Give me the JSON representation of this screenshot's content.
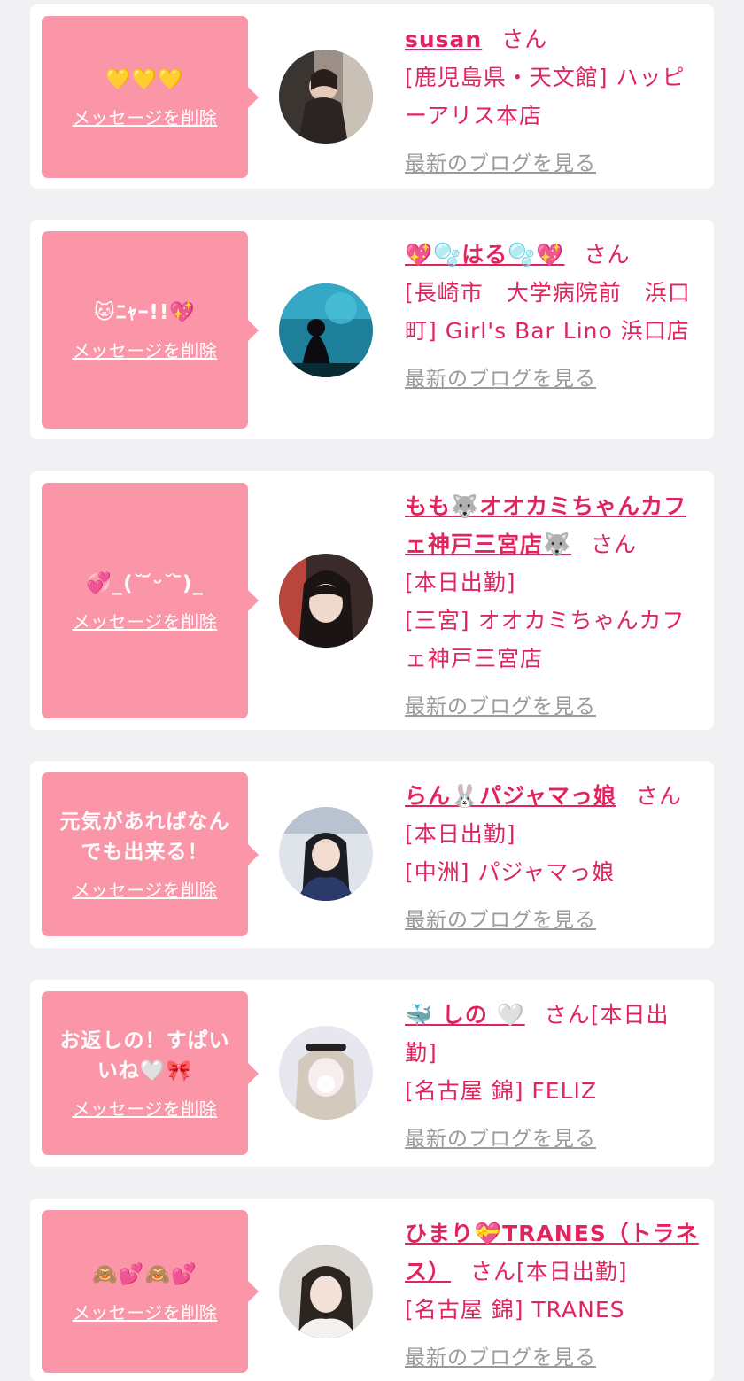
{
  "common": {
    "delete_label": "メッセージを削除",
    "blog_label": "最新のブログを見る",
    "san": "さん"
  },
  "colors": {
    "background": "#f1f1f3",
    "card": "#ffffff",
    "bubble": "#fa96a8",
    "accent": "#e0245e",
    "link_gray": "#9a9a9a"
  },
  "messages": [
    {
      "message": "💛💛💛",
      "name": "susan",
      "san_suffix": "",
      "lines": [
        "[鹿児島県・天文館] ハッピーアリス本店"
      ],
      "avatar_icon": "avatar-photo"
    },
    {
      "message": "🐱ﾆｬｰ!!💖",
      "name": "💖🫧はる🫧💖",
      "san_suffix": "",
      "lines": [
        "[長崎市　大学病院前　浜口町] Girl's Bar Lino 浜口店"
      ],
      "avatar_icon": "avatar-photo"
    },
    {
      "message": "💞_(˘ ᷄ᵕ˘ ᷅)_",
      "name": "もも🐺オオカミちゃんカフェ神戸三宮店🐺",
      "san_suffix": "",
      "lines": [
        "[本日出勤]",
        "[三宮] オオカミちゃんカフェ神戸三宮店"
      ],
      "avatar_icon": "avatar-photo"
    },
    {
      "message": "元気があればなんでも出来る！",
      "name": "らん🐰パジャマっ娘",
      "san_suffix": "[本日出勤]",
      "lines": [
        "[中洲] パジャマっ娘"
      ],
      "avatar_icon": "avatar-photo"
    },
    {
      "message": "お返しの！すぱいいね🤍🎀",
      "name": "🐳 しの 🤍",
      "san_suffix": "[本日出勤]",
      "lines": [
        "[名古屋 錦] FELIZ"
      ],
      "avatar_icon": "avatar-photo"
    },
    {
      "message": "🙈💕🙈💕",
      "name": "ひまり💝TRANES（トラネス）",
      "san_suffix": "[本日出勤]",
      "lines": [
        "[名古屋 錦] TRANES"
      ],
      "avatar_icon": "avatar-photo"
    }
  ]
}
